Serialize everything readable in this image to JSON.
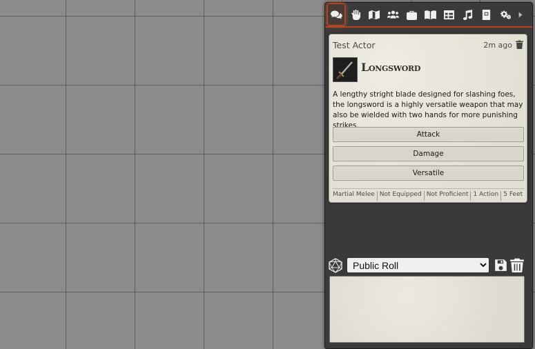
{
  "sidebar": {
    "tabs": [
      {
        "name": "chat-icon",
        "active": true
      },
      {
        "name": "combat-icon"
      },
      {
        "name": "scenes-icon"
      },
      {
        "name": "actors-icon"
      },
      {
        "name": "items-icon"
      },
      {
        "name": "journal-icon"
      },
      {
        "name": "tables-icon"
      },
      {
        "name": "playlists-icon"
      },
      {
        "name": "compendium-icon"
      },
      {
        "name": "settings-icon"
      },
      {
        "name": "collapse-arrow-icon"
      }
    ],
    "accent": "#b8421e"
  },
  "message": {
    "speaker": "Test Actor",
    "timestamp": "2m ago",
    "item_name": "Longsword",
    "description": "A lengthy stright blade designed for slashing foes, the longsword is a highly versatile weapon that may also be wielded with two hands for more punishing strikes.",
    "buttons": {
      "attack": "Attack",
      "damage": "Damage",
      "versatile": "Versatile"
    },
    "tags": [
      "Martial Melee",
      "Not Equipped",
      "Not Proficient",
      "1 Action",
      "5 Feet"
    ]
  },
  "roll": {
    "mode": "Public Roll",
    "options": [
      "Public Roll"
    ]
  }
}
